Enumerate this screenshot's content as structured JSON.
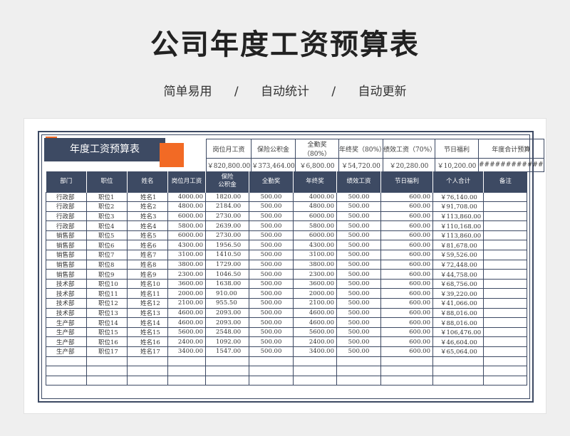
{
  "title": "公司年度工资预算表",
  "subtitle": {
    "part1": "简单易用",
    "sep1": "/",
    "part2": "自动统计",
    "sep2": "/",
    "part3": "自动更新"
  },
  "badge": "年度工资预算表",
  "summary": {
    "headers": [
      "岗位月工资",
      "保险公积金",
      "全勤奖（80%）",
      "年终奖（80%）",
      "绩效工资（70%）",
      "节日福利",
      "年度合计预算"
    ],
    "values": [
      "￥820,800.00",
      "￥373,464.00",
      "￥6,800.00",
      "￥54,720.00",
      "￥20,280.00",
      "￥10,200.00",
      "############"
    ]
  },
  "table": {
    "headers": [
      "部门",
      "职位",
      "姓名",
      "岗位月工资",
      "保险\n公积金",
      "全勤奖",
      "年终奖",
      "绩效工资",
      "节日福利",
      "个人合计",
      "备注"
    ],
    "rows": [
      [
        "行政部",
        "职位1",
        "姓名1",
        "4000.00",
        "1820.00",
        "500.00",
        "4000.00",
        "500.00",
        "600.00",
        "￥76,140.00",
        ""
      ],
      [
        "行政部",
        "职位2",
        "姓名2",
        "4800.00",
        "2184.00",
        "500.00",
        "4800.00",
        "500.00",
        "600.00",
        "￥91,708.00",
        ""
      ],
      [
        "行政部",
        "职位3",
        "姓名3",
        "6000.00",
        "2730.00",
        "500.00",
        "6000.00",
        "500.00",
        "600.00",
        "￥113,860.00",
        ""
      ],
      [
        "行政部",
        "职位4",
        "姓名4",
        "5800.00",
        "2639.00",
        "500.00",
        "5800.00",
        "500.00",
        "600.00",
        "￥110,168.00",
        ""
      ],
      [
        "销售部",
        "职位5",
        "姓名5",
        "6000.00",
        "2730.00",
        "500.00",
        "6000.00",
        "500.00",
        "600.00",
        "￥113,860.00",
        ""
      ],
      [
        "销售部",
        "职位6",
        "姓名6",
        "4300.00",
        "1956.50",
        "500.00",
        "4300.00",
        "500.00",
        "600.00",
        "￥81,678.00",
        ""
      ],
      [
        "销售部",
        "职位7",
        "姓名7",
        "3100.00",
        "1410.50",
        "500.00",
        "3100.00",
        "500.00",
        "600.00",
        "￥59,526.00",
        ""
      ],
      [
        "销售部",
        "职位8",
        "姓名8",
        "3800.00",
        "1729.00",
        "500.00",
        "3800.00",
        "500.00",
        "600.00",
        "￥72,448.00",
        ""
      ],
      [
        "销售部",
        "职位9",
        "姓名9",
        "2300.00",
        "1046.50",
        "500.00",
        "2300.00",
        "500.00",
        "600.00",
        "￥44,758.00",
        ""
      ],
      [
        "技术部",
        "职位10",
        "姓名10",
        "3600.00",
        "1638.00",
        "500.00",
        "3600.00",
        "500.00",
        "600.00",
        "￥68,756.00",
        ""
      ],
      [
        "技术部",
        "职位11",
        "姓名11",
        "2000.00",
        "910.00",
        "500.00",
        "2000.00",
        "500.00",
        "600.00",
        "￥39,220.00",
        ""
      ],
      [
        "技术部",
        "职位12",
        "姓名12",
        "2100.00",
        "955.50",
        "500.00",
        "2100.00",
        "500.00",
        "600.00",
        "￥41,066.00",
        ""
      ],
      [
        "技术部",
        "职位13",
        "姓名13",
        "4600.00",
        "2093.00",
        "500.00",
        "4600.00",
        "500.00",
        "600.00",
        "￥88,016.00",
        ""
      ],
      [
        "生产部",
        "职位14",
        "姓名14",
        "4600.00",
        "2093.00",
        "500.00",
        "4600.00",
        "500.00",
        "600.00",
        "￥88,016.00",
        ""
      ],
      [
        "生产部",
        "职位15",
        "姓名15",
        "5600.00",
        "2548.00",
        "500.00",
        "5600.00",
        "500.00",
        "600.00",
        "￥106,476.00",
        ""
      ],
      [
        "生产部",
        "职位16",
        "姓名16",
        "2400.00",
        "1092.00",
        "500.00",
        "2400.00",
        "500.00",
        "600.00",
        "￥46,604.00",
        ""
      ],
      [
        "生产部",
        "职位17",
        "姓名17",
        "3400.00",
        "1547.00",
        "500.00",
        "3400.00",
        "500.00",
        "600.00",
        "￥65,064.00",
        ""
      ],
      [
        "",
        "",
        "",
        "",
        "",
        "",
        "",
        "",
        "",
        "",
        ""
      ],
      [
        "",
        "",
        "",
        "",
        "",
        "",
        "",
        "",
        "",
        "",
        ""
      ],
      [
        "",
        "",
        "",
        "",
        "",
        "",
        "",
        "",
        "",
        "",
        ""
      ]
    ]
  },
  "colors": {
    "header_bg": "#3d4a63",
    "accent": "#f26a25"
  }
}
